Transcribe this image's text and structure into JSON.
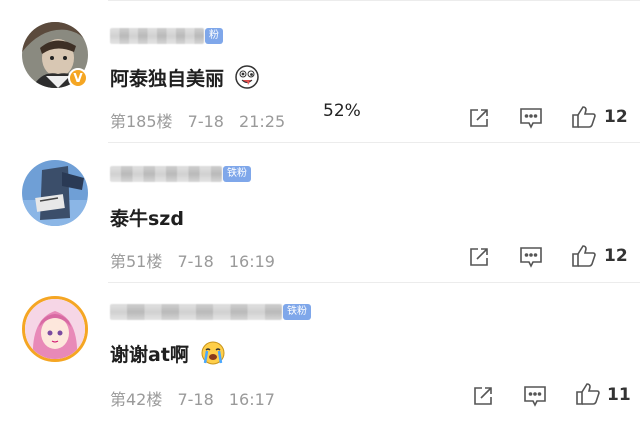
{
  "colors": {
    "fan_badge": "#7fa7ea",
    "verified_badge": "#f5a623",
    "meta_text": "#9a9a9a",
    "divider": "#ececec"
  },
  "overlay": {
    "percent_text": "52%"
  },
  "comments": [
    {
      "fan_badge": "粉",
      "text": "阿泰独自美丽",
      "emoji": "goofy-face-emoji",
      "floor": "第185楼",
      "date": "7-18",
      "time": "21:25",
      "likes": "12",
      "verified": true
    },
    {
      "fan_badge": "铁粉",
      "text": "泰牛szd",
      "emoji": "",
      "floor": "第51楼",
      "date": "7-18",
      "time": "16:19",
      "likes": "12",
      "verified": false
    },
    {
      "fan_badge": "铁粉",
      "text": "谢谢at啊",
      "emoji": "crying-face-emoji",
      "floor": "第42楼",
      "date": "7-18",
      "time": "16:17",
      "likes": "11",
      "verified": false
    }
  ],
  "icons": [
    "share-icon",
    "comment-icon",
    "like-icon"
  ]
}
